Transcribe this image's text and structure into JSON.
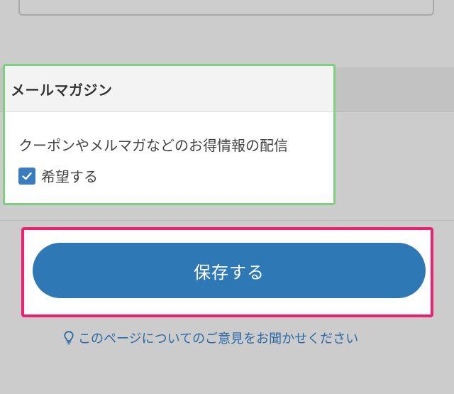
{
  "newsletter": {
    "title": "メールマガジン",
    "description": "クーポンやメルマガなどのお得情報の配信",
    "checkbox_label": "希望する",
    "checked": true
  },
  "actions": {
    "save_label": "保存する"
  },
  "feedback": {
    "link_text": "このページについてのご意見をお聞かせください",
    "icon": "lightbulb-icon"
  },
  "colors": {
    "background_dim": "#cccccc",
    "primary_blue": "#2f78b6",
    "highlight_green": "#7dd07f",
    "highlight_pink": "#ee1f6f",
    "link_blue": "#2c6aa6"
  }
}
